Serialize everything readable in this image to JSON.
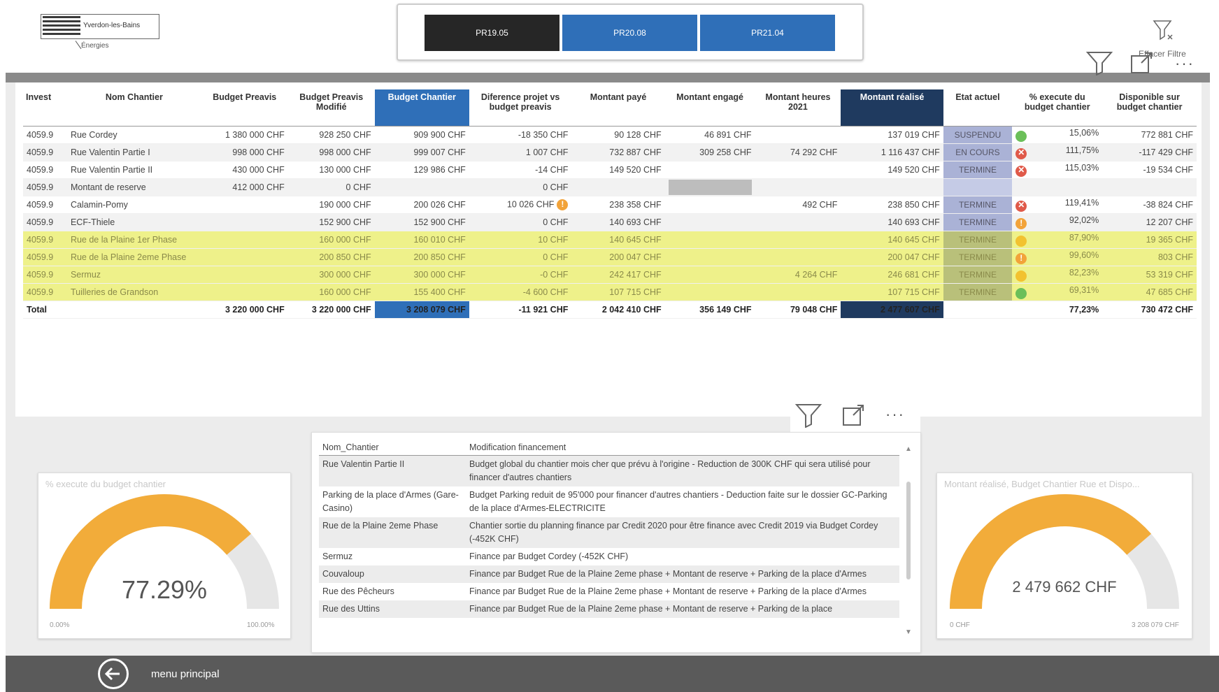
{
  "logo": {
    "name": "Yverdon-les-Bains",
    "sub": "Énergies"
  },
  "projects": [
    {
      "label": "PR19.05",
      "active": true
    },
    {
      "label": "PR20.08",
      "active": false
    },
    {
      "label": "PR21.04",
      "active": false
    }
  ],
  "toolbar": {
    "clear_filter_label": "Effacer Filtre"
  },
  "table": {
    "headers": [
      "Invest",
      "Nom Chantier",
      "Budget Preavis",
      "Budget Preavis Modifié",
      "Budget Chantier",
      "Diference projet vs budget preavis",
      "Montant payé",
      "Montant engagé",
      "Montant heures 2021",
      "Montant réalisé",
      "Etat actuel",
      "% execute du budget chantier",
      "Disponible sur budget chantier"
    ],
    "rows": [
      {
        "invest": "4059.9",
        "nom": "Rue Cordey",
        "bp": "1 380 000 CHF",
        "bpm": "928 250 CHF",
        "bc": "909 900 CHF",
        "diff": "-18 350 CHF",
        "paye": "90 128 CHF",
        "engage": "46 891 CHF",
        "heures": "",
        "realise": "137 019 CHF",
        "etat": "SUSPENDU",
        "dot": "green",
        "pct": "15,06%",
        "dispo": "772 881 CHF",
        "style": "normal"
      },
      {
        "invest": "4059.9",
        "nom": "Rue Valentin Partie I",
        "bp": "998 000 CHF",
        "bpm": "998 000 CHF",
        "bc": "999 007 CHF",
        "diff": "1 007 CHF",
        "paye": "732 887 CHF",
        "engage": "309 258 CHF",
        "heures": "74 292 CHF",
        "realise": "1 116 437 CHF",
        "etat": "EN COURS",
        "dot": "red",
        "pct": "111,75%",
        "dispo": "-117 429 CHF",
        "style": "alt"
      },
      {
        "invest": "4059.9",
        "nom": "Rue Valentin Partie II",
        "bp": "430 000 CHF",
        "bpm": "130 000 CHF",
        "bc": "129 986 CHF",
        "diff": "-14 CHF",
        "paye": "149 520 CHF",
        "engage": "",
        "heures": "",
        "realise": "149 520 CHF",
        "etat": "TERMINE",
        "dot": "red",
        "pct": "115,03%",
        "dispo": "-19 534 CHF",
        "style": "normal"
      },
      {
        "invest": "4059.9",
        "nom": "Montant de reserve",
        "bp": "412 000 CHF",
        "bpm": "0 CHF",
        "bc": "",
        "diff": "0 CHF",
        "paye": "",
        "engage": "",
        "heures": "",
        "realise": "",
        "etat": "",
        "dot": "",
        "pct": "",
        "dispo": "",
        "style": "alt"
      },
      {
        "invest": "4059.9",
        "nom": "Calamin-Pomy",
        "bp": "",
        "bpm": "190 000 CHF",
        "bc": "200 026 CHF",
        "diff": "10 026 CHF",
        "paye": "238 358 CHF",
        "engage": "",
        "heures": "492 CHF",
        "realise": "238 850 CHF",
        "etat": "TERMINE",
        "dot": "red",
        "pct": "119,41%",
        "dispo": "-38 824 CHF",
        "style": "normal"
      },
      {
        "invest": "4059.9",
        "nom": "ECF-Thiele",
        "bp": "",
        "bpm": "152 900 CHF",
        "bc": "152 900 CHF",
        "diff": "0 CHF",
        "paye": "140 693 CHF",
        "engage": "",
        "heures": "",
        "realise": "140 693 CHF",
        "etat": "TERMINE",
        "dot": "orange",
        "pct": "92,02%",
        "dispo": "12 207 CHF",
        "style": "alt"
      },
      {
        "invest": "4059.9",
        "nom": "Rue de la Plaine 1er Phase",
        "bp": "",
        "bpm": "160 000 CHF",
        "bc": "160 010 CHF",
        "diff": "10 CHF",
        "paye": "140 645 CHF",
        "engage": "",
        "heures": "",
        "realise": "140 645 CHF",
        "etat": "TERMINE",
        "dot": "yellow",
        "pct": "87,90%",
        "dispo": "19 365 CHF",
        "style": "yellow"
      },
      {
        "invest": "4059.9",
        "nom": "Rue de la Plaine 2eme Phase",
        "bp": "",
        "bpm": "200 850 CHF",
        "bc": "200 850 CHF",
        "diff": "0 CHF",
        "paye": "200 047 CHF",
        "engage": "",
        "heures": "",
        "realise": "200 047 CHF",
        "etat": "TERMINE",
        "dot": "orange",
        "pct": "99,60%",
        "dispo": "803 CHF",
        "style": "yellow"
      },
      {
        "invest": "4059.9",
        "nom": "Sermuz",
        "bp": "",
        "bpm": "300 000 CHF",
        "bc": "300 000 CHF",
        "diff": "-0 CHF",
        "paye": "242 417 CHF",
        "engage": "",
        "heures": "4 264 CHF",
        "realise": "246 681 CHF",
        "etat": "TERMINE",
        "dot": "yellow",
        "pct": "82,23%",
        "dispo": "53 319 CHF",
        "style": "yellow"
      },
      {
        "invest": "4059.9",
        "nom": "Tuilleries de Grandson",
        "bp": "",
        "bpm": "160 000 CHF",
        "bc": "155 400 CHF",
        "diff": "-4 600 CHF",
        "paye": "107 715 CHF",
        "engage": "",
        "heures": "",
        "realise": "107 715 CHF",
        "etat": "TERMINE",
        "dot": "green",
        "pct": "69,31%",
        "dispo": "47 685 CHF",
        "style": "yellow"
      }
    ],
    "total": {
      "label": "Total",
      "bp": "3 220 000 CHF",
      "bpm": "3 220 000 CHF",
      "bc": "3 208 079 CHF",
      "diff": "-11 921 CHF",
      "paye": "2 042 410 CHF",
      "engage": "356 149 CHF",
      "heures": "79 048 CHF",
      "realise": "2 477 607 CHF",
      "pct": "77,23%",
      "dispo": "730 472 CHF"
    }
  },
  "gauge_left": {
    "title": "% execute du budget chantier",
    "value": "77.29%",
    "min": "0.00%",
    "max": "100.00%",
    "fraction": 0.7729
  },
  "gauge_right": {
    "title": "Montant réalisé, Budget Chantier Rue et Dispo...",
    "value": "2 479 662 CHF",
    "min": "0 CHF",
    "max": "3 208 079 CHF",
    "fraction": 0.773
  },
  "mid_table": {
    "headers": [
      "Nom_Chantier",
      "Modification financement"
    ],
    "rows": [
      {
        "nom": "Rue Valentin Partie II",
        "mod": "Budget global du chantier mois cher que prévu à l'origine - Reduction de 300K CHF qui sera utilisé pour financer d'autres chantiers"
      },
      {
        "nom": "Parking de la place d'Armes (Gare-Casino)",
        "mod": "Budget Parking reduit de 95'000 pour financer d'autres chantiers - Deduction faite sur le dossier GC-Parking de la place d'Armes-ELECTRICITE"
      },
      {
        "nom": "Rue de la Plaine 2eme Phase",
        "mod": "Chantier sortie du planning finance par Credit 2020 pour être finance avec Credit 2019 via Budget Cordey (-452K CHF)"
      },
      {
        "nom": "Sermuz",
        "mod": "Finance par Budget Cordey (-452K CHF)"
      },
      {
        "nom": "Couvaloup",
        "mod": "Finance par Budget Rue de la Plaine 2eme phase + Montant de reserve + Parking de la place d'Armes"
      },
      {
        "nom": "Rue des Pêcheurs",
        "mod": "Finance par Budget Rue de la Plaine 2eme phase + Montant de reserve + Parking de la place d'Armes"
      },
      {
        "nom": "Rue des Uttins",
        "mod": "Finance par Budget Rue de la Plaine 2eme phase + Montant de reserve + Parking de la place"
      }
    ]
  },
  "footer": {
    "back_label": "menu principal"
  },
  "colors": {
    "accent_blue": "#2f6fb8",
    "dark_navy": "#1f3a5f",
    "gauge_fill": "#f2ac3a",
    "gauge_track": "#e6e6e6",
    "highlight_yellow": "#eef18a"
  }
}
